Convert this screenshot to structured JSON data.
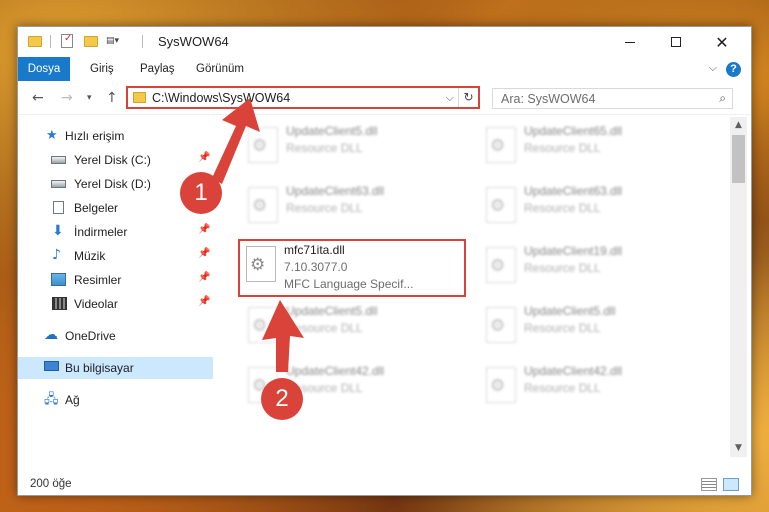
{
  "window": {
    "title": "SysWOW64"
  },
  "ribbon": {
    "tabs": [
      "Dosya",
      "Giriş",
      "Paylaş",
      "Görünüm"
    ]
  },
  "address_bar": {
    "path": "C:\\Windows\\SysWOW64"
  },
  "search": {
    "placeholder": "Ara: SysWOW64"
  },
  "sidebar": {
    "items": [
      {
        "label": "Hızlı erişim",
        "icon": "star-icon",
        "pinned": false
      },
      {
        "label": "Yerel Disk (C:)",
        "icon": "disk-icon",
        "pinned": true
      },
      {
        "label": "Yerel Disk (D:)",
        "icon": "disk-icon",
        "pinned": false
      },
      {
        "label": "Belgeler",
        "icon": "document-icon",
        "pinned": true
      },
      {
        "label": "İndirmeler",
        "icon": "download-icon",
        "pinned": true
      },
      {
        "label": "Müzik",
        "icon": "music-icon",
        "pinned": true
      },
      {
        "label": "Resimler",
        "icon": "picture-icon",
        "pinned": true
      },
      {
        "label": "Videolar",
        "icon": "video-icon",
        "pinned": true
      },
      {
        "label": "OneDrive",
        "icon": "cloud-icon",
        "pinned": false
      },
      {
        "label": "Bu bilgisayar",
        "icon": "computer-icon",
        "pinned": false,
        "selected": true
      },
      {
        "label": "Ağ",
        "icon": "network-icon",
        "pinned": false
      }
    ]
  },
  "files": {
    "left_column": [
      {
        "name": "UpdateClient5.dll",
        "desc": "Resource DLL"
      },
      {
        "name": "UpdateClient63.dll",
        "desc": "Resource DLL"
      },
      {
        "name": "UpdateClient5.dll",
        "desc": "Resource DLL"
      },
      {
        "name": "UpdateClient42.dll",
        "desc": "Resource DLL"
      }
    ],
    "right_column": [
      {
        "name": "UpdateClient65.dll",
        "desc": "Resource DLL"
      },
      {
        "name": "UpdateClient63.dll",
        "desc": "Resource DLL"
      },
      {
        "name": "UpdateClient19.dll",
        "desc": "Resource DLL"
      },
      {
        "name": "UpdateClient5.dll",
        "desc": "Resource DLL"
      },
      {
        "name": "UpdateClient42.dll",
        "desc": "Resource DLL"
      }
    ],
    "highlighted": {
      "name": "mfc71ita.dll",
      "version": "7.10.3077.0",
      "description": "MFC Language Specif..."
    }
  },
  "status": {
    "item_count": "200 öğe"
  },
  "annotations": {
    "step1": "1",
    "step2": "2",
    "color": "#d9433a"
  }
}
